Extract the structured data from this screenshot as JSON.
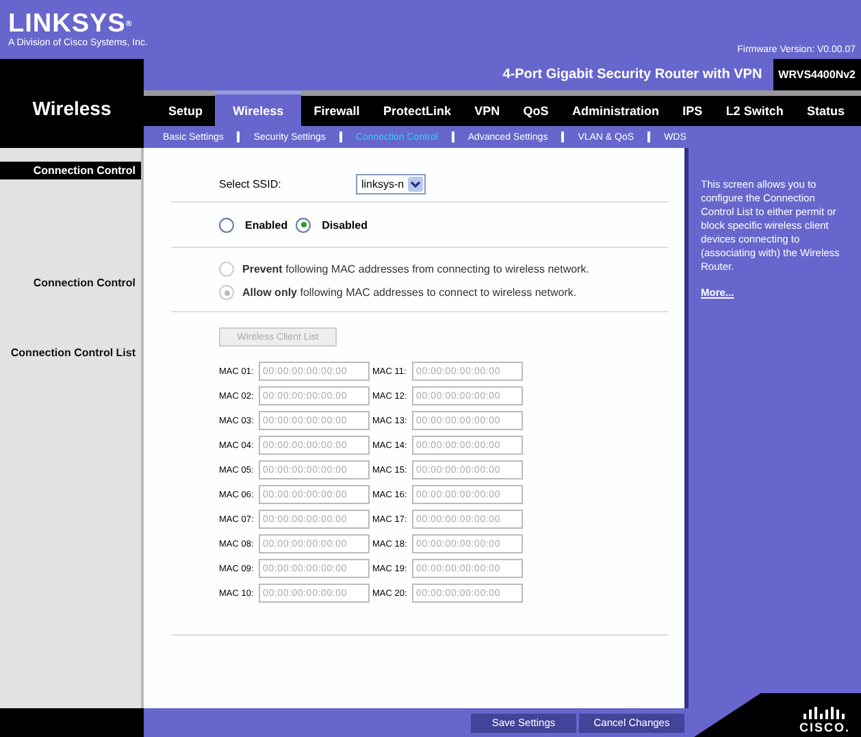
{
  "header": {
    "logo": "LINKSYS",
    "registered": "®",
    "tagline": "A Division of Cisco Systems, Inc.",
    "firmware": "Firmware Version: V0.00.07"
  },
  "page_title": "Wireless",
  "product": {
    "name": "4-Port Gigabit Security Router with VPN",
    "model": "WRVS4400Nv2"
  },
  "tabs": [
    {
      "label": "Setup",
      "selected": false
    },
    {
      "label": "Wireless",
      "selected": true
    },
    {
      "label": "Firewall",
      "selected": false
    },
    {
      "label": "ProtectLink",
      "selected": false
    },
    {
      "label": "VPN",
      "selected": false
    },
    {
      "label": "QoS",
      "selected": false
    },
    {
      "label": "Administration",
      "selected": false
    },
    {
      "label": "IPS",
      "selected": false
    },
    {
      "label": "L2 Switch",
      "selected": false
    },
    {
      "label": "Status",
      "selected": false
    }
  ],
  "subtabs": [
    {
      "label": "Basic Settings",
      "selected": false
    },
    {
      "label": "Security Settings",
      "selected": false
    },
    {
      "label": "Connection Control",
      "selected": true
    },
    {
      "label": "Advanced Settings",
      "selected": false
    },
    {
      "label": "VLAN & QoS",
      "selected": false
    },
    {
      "label": "WDS",
      "selected": false
    }
  ],
  "sidebar": {
    "section": "Connection Control",
    "labels": [
      "Connection Control",
      "Connection Control List"
    ]
  },
  "ssid": {
    "label": "Select SSID:",
    "value": "linksys-n"
  },
  "state": [
    {
      "label": "Enabled",
      "selected": false
    },
    {
      "label": "Disabled",
      "selected": true
    }
  ],
  "mode": {
    "disabled": true,
    "options": [
      {
        "label": "**Prevent** following MAC addresses from connecting to wireless network.",
        "selected": false
      },
      {
        "label": "**Allow only** following MAC addresses to connect to wireless network.",
        "selected": true
      }
    ]
  },
  "client_list_button": {
    "label": "Wireless Client List",
    "disabled": true
  },
  "mac_table": {
    "disabled": true,
    "columns": [
      [
        {
          "label": "MAC 01:",
          "value": "00:00:00:00:00:00"
        },
        {
          "label": "MAC 02:",
          "value": "00:00:00:00:00:00"
        },
        {
          "label": "MAC 03:",
          "value": "00:00:00:00:00:00"
        },
        {
          "label": "MAC 04:",
          "value": "00:00:00:00:00:00"
        },
        {
          "label": "MAC 05:",
          "value": "00:00:00:00:00:00"
        },
        {
          "label": "MAC 06:",
          "value": "00:00:00:00:00:00"
        },
        {
          "label": "MAC 07:",
          "value": "00:00:00:00:00:00"
        },
        {
          "label": "MAC 08:",
          "value": "00:00:00:00:00:00"
        },
        {
          "label": "MAC 09:",
          "value": "00:00:00:00:00:00"
        },
        {
          "label": "MAC 10:",
          "value": "00:00:00:00:00:00"
        }
      ],
      [
        {
          "label": "MAC 11:",
          "value": "00:00:00:00:00:00"
        },
        {
          "label": "MAC 12:",
          "value": "00:00:00:00:00:00"
        },
        {
          "label": "MAC 13:",
          "value": "00:00:00:00:00:00"
        },
        {
          "label": "MAC 14:",
          "value": "00:00:00:00:00:00"
        },
        {
          "label": "MAC 15:",
          "value": "00:00:00:00:00:00"
        },
        {
          "label": "MAC 16:",
          "value": "00:00:00:00:00:00"
        },
        {
          "label": "MAC 17:",
          "value": "00:00:00:00:00:00"
        },
        {
          "label": "MAC 18:",
          "value": "00:00:00:00:00:00"
        },
        {
          "label": "MAC 19:",
          "value": "00:00:00:00:00:00"
        },
        {
          "label": "MAC 20:",
          "value": "00:00:00:00:00:00"
        }
      ]
    ]
  },
  "help": {
    "text": "This screen allows you to configure the Connection Control List to either permit or block specific wireless client devices connecting to (associating with) the Wireless Router.",
    "link": "More..."
  },
  "footer": {
    "buttons": [
      "Save Settings",
      "Cancel Changes"
    ],
    "brand": "CISCO."
  }
}
